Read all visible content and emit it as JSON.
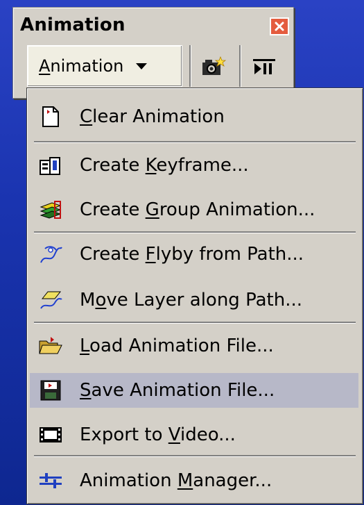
{
  "window": {
    "title": "Animation"
  },
  "toolbar": {
    "dropdown_label": "Animation",
    "dropdown_underline": "A",
    "icons": [
      "camera-icon",
      "play-pause-icon"
    ]
  },
  "menu": {
    "items": [
      {
        "pre": "",
        "u": "C",
        "post": "lear Animation",
        "icon": "blank-page-icon"
      },
      {
        "pre": "Create ",
        "u": "K",
        "post": "eyframe...",
        "icon": "keyframe-icon"
      },
      {
        "pre": "Create ",
        "u": "G",
        "post": "roup Animation...",
        "icon": "group-layers-icon"
      },
      {
        "pre": "Create ",
        "u": "F",
        "post": "lyby from Path...",
        "icon": "flyby-path-icon"
      },
      {
        "pre": "M",
        "u": "o",
        "post": "ve Layer along Path...",
        "icon": "move-layer-path-icon"
      },
      {
        "pre": "",
        "u": "L",
        "post": "oad Animation File...",
        "icon": "open-folder-icon"
      },
      {
        "pre": "",
        "u": "S",
        "post": "ave Animation File...",
        "icon": "floppy-disk-icon"
      },
      {
        "pre": "Export to ",
        "u": "V",
        "post": "ideo...",
        "icon": "film-strip-icon"
      },
      {
        "pre": "Animation ",
        "u": "M",
        "post": "anager...",
        "icon": "manager-sliders-icon"
      }
    ]
  },
  "colors": {
    "desktop": "#1a34b0",
    "menu_bg": "#d4d0c8",
    "hover": "#b7b8c8",
    "close": "#e45c3e"
  }
}
